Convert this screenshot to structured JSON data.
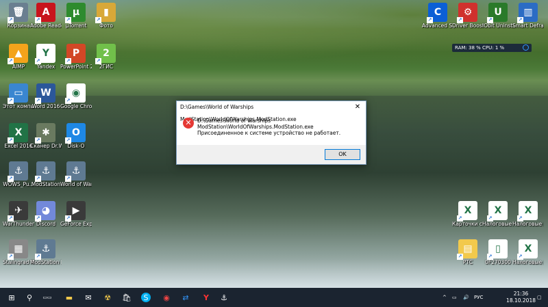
{
  "dialog": {
    "title": "D:\\Games\\World of Warships ModStation\\WorldOfWarships.ModStation.exe",
    "close_glyph": "✕",
    "error_icon": "error-icon",
    "path": "D:\\Games\\World of Warships ModStation\\WorldOfWarships.ModStation.exe",
    "message": "Присоединенное к системе устройство не работает.",
    "ok_label": "OK"
  },
  "desktop_icons": [
    {
      "name": "recycle-bin",
      "label": "Корзина",
      "glyph": "🗑",
      "bg": "#6a7f90"
    },
    {
      "name": "adobe-reader",
      "label": "Adobe Reader XI",
      "glyph": "A",
      "bg": "#c8141c"
    },
    {
      "name": "utorrent",
      "label": "µTorrent",
      "glyph": "µ",
      "bg": "#2e8b2e"
    },
    {
      "name": "foto-folder",
      "label": "Фото",
      "glyph": "▮",
      "bg": "#d8a838"
    },
    {
      "name": "aimp",
      "label": "AIMP",
      "glyph": "▲",
      "bg": "#f3a31b"
    },
    {
      "name": "yandex",
      "label": "Yandex",
      "glyph": "Y",
      "bg": "#ffffff"
    },
    {
      "name": "powerpoint",
      "label": "PowerPoint 2016",
      "glyph": "P",
      "bg": "#d24726"
    },
    {
      "name": "2gis",
      "label": "2ГИС",
      "glyph": "2",
      "bg": "#71c04a"
    },
    {
      "name": "this-pc",
      "label": "Этот компьютер",
      "glyph": "▭",
      "bg": "#3a86d0"
    },
    {
      "name": "word",
      "label": "Word 2016",
      "glyph": "W",
      "bg": "#2b579a"
    },
    {
      "name": "chrome",
      "label": "Google Chrome",
      "glyph": "◉",
      "bg": "#ffffff"
    },
    {
      "name": "excel",
      "label": "Excel 2016",
      "glyph": "X",
      "bg": "#217346"
    },
    {
      "name": "drweb",
      "label": "Сканер Dr.Web",
      "glyph": "✱",
      "bg": "#6a7a60"
    },
    {
      "name": "disk-o",
      "label": "Disk-O",
      "glyph": "O",
      "bg": "#1e88e5"
    },
    {
      "name": "wows-pu",
      "label": "WOWS_Pu...",
      "glyph": "⚓",
      "bg": "#5f7a92"
    },
    {
      "name": "modstation",
      "label": "ModStation",
      "glyph": "⚓",
      "bg": "#5f7a92"
    },
    {
      "name": "world-of-warships",
      "label": "World of Warships",
      "glyph": "⚓",
      "bg": "#5f7a92"
    },
    {
      "name": "warthunder",
      "label": "WarThunder",
      "glyph": "✈",
      "bg": "#3a3a3a"
    },
    {
      "name": "discord",
      "label": "Discord",
      "glyph": "◕",
      "bg": "#7289da"
    },
    {
      "name": "geforce",
      "label": "GeForce Experience",
      "glyph": "▶",
      "bg": "#3a3a3a"
    },
    {
      "name": "stalingrad",
      "label": "Stalingrad 4bots",
      "glyph": "▦",
      "bg": "#888888"
    },
    {
      "name": "modstation-diagnost",
      "label": "ModStation Diagnost",
      "glyph": "⚓",
      "bg": "#5f7a92"
    },
    {
      "name": "advanced-systemcare",
      "label": "Advanced SystemC...",
      "glyph": "C",
      "bg": "#0b5fd6"
    },
    {
      "name": "driver-booster",
      "label": "Driver Booster 5",
      "glyph": "⚙",
      "bg": "#d0312d"
    },
    {
      "name": "iobit-uninstaller",
      "label": "IObit Uninstaller",
      "glyph": "U",
      "bg": "#2a7a2a"
    },
    {
      "name": "smart-defrag",
      "label": "Smart Defrag 6",
      "glyph": "▥",
      "bg": "#2b6cc4"
    },
    {
      "name": "kartochki",
      "label": "Карточки счетов",
      "glyph": "X",
      "bg": "#ffffff"
    },
    {
      "name": "nalog1",
      "label": "Налоговые регистры...",
      "glyph": "X",
      "bg": "#ffffff"
    },
    {
      "name": "nalog2",
      "label": "Налоговые регистры...",
      "glyph": "X",
      "bg": "#ffffff"
    },
    {
      "name": "rtc",
      "label": "РТС",
      "glyph": "▤",
      "bg": "#f2c94c"
    },
    {
      "name": "0f270300",
      "label": "0F270300",
      "glyph": "▯",
      "bg": "#ffffff"
    },
    {
      "name": "nalog3",
      "label": "Налоговые регистры...",
      "glyph": "X",
      "bg": "#ffffff"
    }
  ],
  "monitor": {
    "text": "RAM: 38 %  CPU: 1 %"
  },
  "taskbar": {
    "start_glyph": "⊞",
    "search_glyph": "⚲",
    "taskview_glyph": "▭▭",
    "folder_glyph": "▬",
    "mail_glyph": "✉",
    "app1_glyph": "☢",
    "store_glyph": "🛍",
    "skype_glyph": "S",
    "chrome_glyph": "◉",
    "teamviewer_glyph": "⇄",
    "yandex_glyph": "Y",
    "wows_glyph": "⚓",
    "tray_up": "^",
    "tray_net": "▭",
    "tray_sound": "🔊",
    "lang": "РУС",
    "time": "21:36",
    "date": "18.10.2018",
    "notif_glyph": "▢"
  }
}
